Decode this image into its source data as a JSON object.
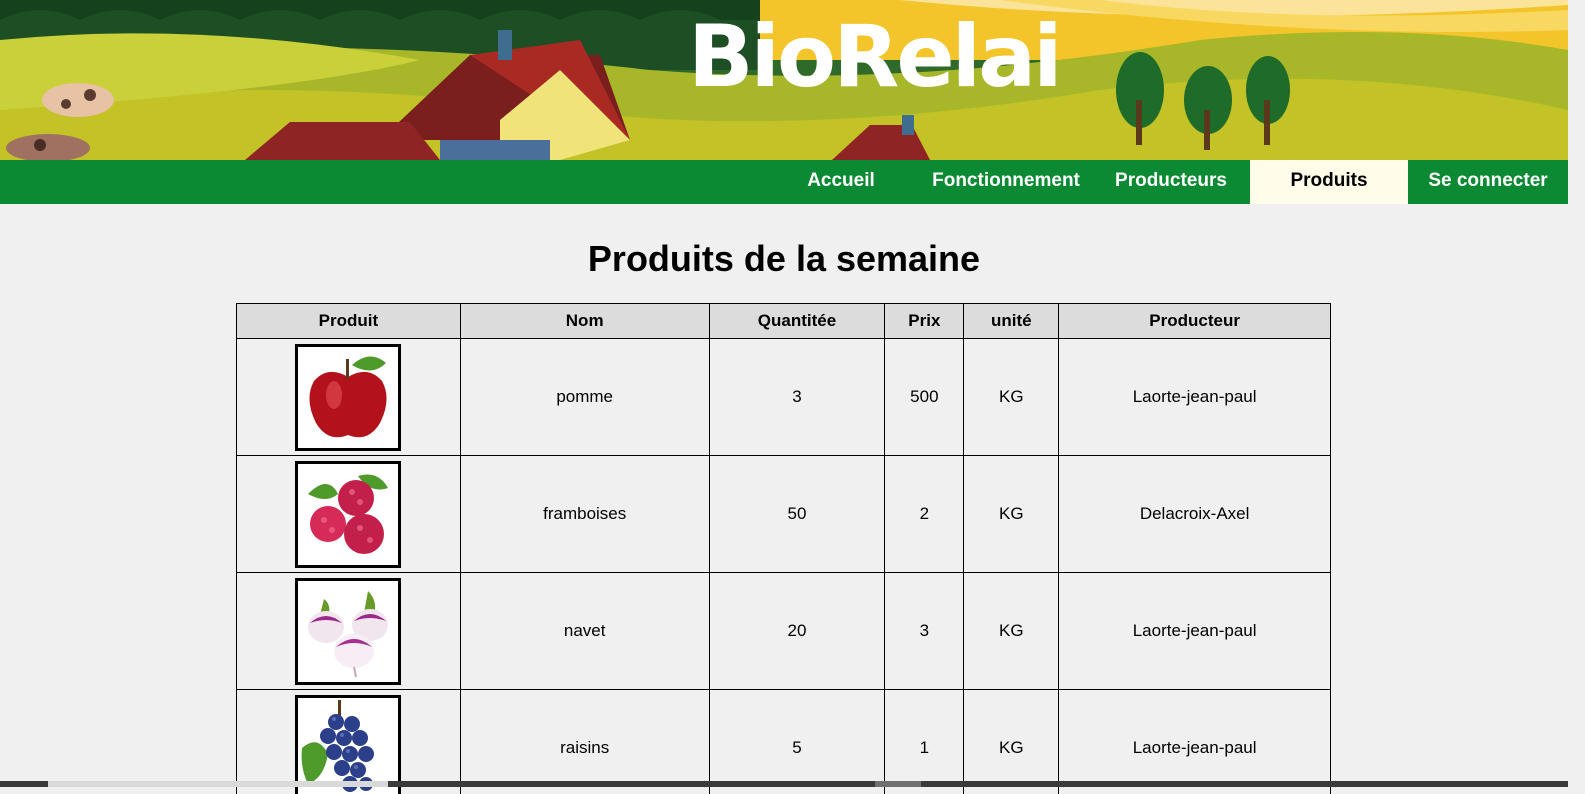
{
  "banner": {
    "logo_text": "BioRelai"
  },
  "nav": {
    "items": [
      {
        "label": "Accueil"
      },
      {
        "label": "Fonctionnement"
      },
      {
        "label": "Producteurs"
      },
      {
        "label": "Produits"
      },
      {
        "label": "Se connecter"
      }
    ],
    "active_index": 3
  },
  "page": {
    "title": "Produits de la semaine"
  },
  "table": {
    "headers": [
      "Produit",
      "Nom",
      "Quantitée",
      "Prix",
      "unité",
      "Producteur"
    ],
    "rows": [
      {
        "image_icon": "apple-icon",
        "nom": "pomme",
        "quantite": "3",
        "prix": "500",
        "unite": "KG",
        "producteur": "Laorte-jean-paul"
      },
      {
        "image_icon": "raspberry-icon",
        "nom": "framboises",
        "quantite": "50",
        "prix": "2",
        "unite": "KG",
        "producteur": "Delacroix-Axel"
      },
      {
        "image_icon": "turnip-icon",
        "nom": "navet",
        "quantite": "20",
        "prix": "3",
        "unite": "KG",
        "producteur": "Laorte-jean-paul"
      },
      {
        "image_icon": "grapes-icon",
        "nom": "raisins",
        "quantite": "5",
        "prix": "1",
        "unite": "KG",
        "producteur": "Laorte-jean-paul"
      }
    ]
  },
  "colors": {
    "nav_green": "#0b8a33",
    "active_tab": "#fffde9",
    "page_bg": "#f0f0f0",
    "header_bg": "#dcdcdc"
  }
}
